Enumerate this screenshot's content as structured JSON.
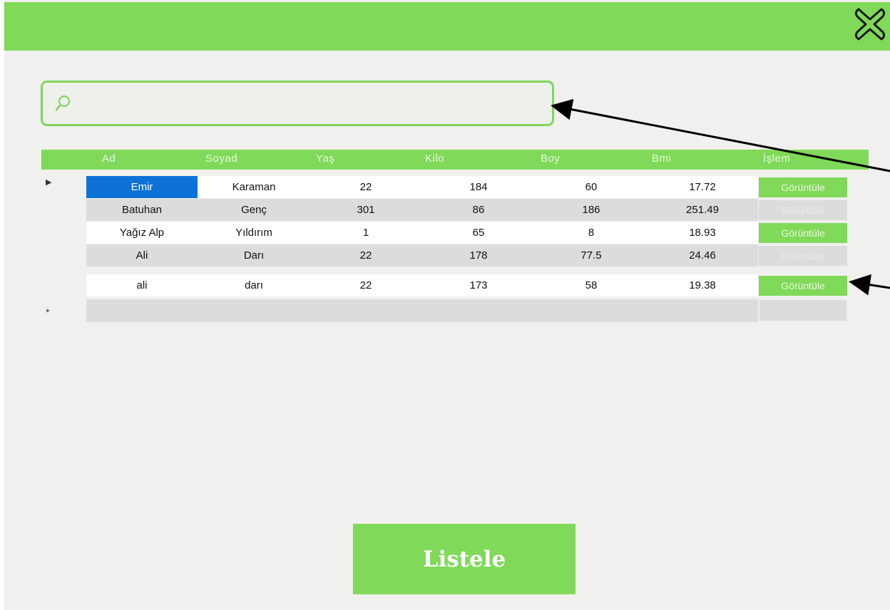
{
  "colors": {
    "accent": "#80d958",
    "selected": "#0c72d6",
    "background": "#f0f0ee"
  },
  "title_bar": {
    "close_icon": "close-icon"
  },
  "search": {
    "icon": "search-icon",
    "placeholder": "",
    "value": ""
  },
  "grid": {
    "columns": [
      "Ad",
      "Soyad",
      "Yaş",
      "Kilo",
      "Boy",
      "Bmi",
      "İşlem"
    ],
    "rows": [
      {
        "ad": "Emir",
        "soyad": "Karaman",
        "yas": "22",
        "kilo": "184",
        "boy": "60",
        "bmi": "17.72",
        "islem": "Görüntüle"
      },
      {
        "ad": "Batuhan",
        "soyad": "Genç",
        "yas": "301",
        "kilo": "86",
        "boy": "186",
        "bmi": "251.49",
        "islem": "Görüntüle"
      },
      {
        "ad": "Yağız Alp",
        "soyad": "Yıldırım",
        "yas": "1",
        "kilo": "65",
        "boy": "8",
        "bmi": "18.93",
        "islem": "Görüntüle"
      },
      {
        "ad": "Ali",
        "soyad": "Darı",
        "yas": "22",
        "kilo": "178",
        "boy": "77.5",
        "bmi": "24.46",
        "islem": "Görüntüle"
      },
      {
        "ad": "ali",
        "soyad": "darı",
        "yas": "22",
        "kilo": "173",
        "boy": "58",
        "bmi": "19.38",
        "islem": "Görüntüle"
      }
    ],
    "current_row_marker": "▶",
    "new_row_marker": "*"
  },
  "footer": {
    "listele_label": "Listele"
  }
}
